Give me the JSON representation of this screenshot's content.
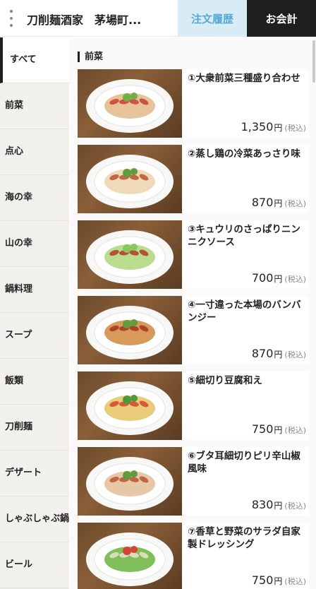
{
  "header": {
    "store_name": "刀削麺酒家　茅場町...",
    "history_label": "注文履歴",
    "checkout_label": "お会計"
  },
  "sidebar": {
    "items": [
      {
        "label": "すべて",
        "active": true
      },
      {
        "label": "前菜"
      },
      {
        "label": "点心"
      },
      {
        "label": "海の幸"
      },
      {
        "label": "山の幸"
      },
      {
        "label": "鍋料理"
      },
      {
        "label": "スープ"
      },
      {
        "label": "飯類"
      },
      {
        "label": "刀削麺"
      },
      {
        "label": "デザート"
      },
      {
        "label": "しゃぶしゃぶ鍋"
      },
      {
        "label": "ビール"
      }
    ]
  },
  "main": {
    "section_title": "前菜",
    "price_unit": "円",
    "tax_label": "(税込)",
    "items": [
      {
        "name": "①大衆前菜三種盛り合わせ",
        "price": "1,350",
        "dish": "platter"
      },
      {
        "name": "②蒸し鶏の冷菜あっさり味",
        "price": "870",
        "dish": "chicken"
      },
      {
        "name": "③キュウリのさっぱりニンニクソース",
        "price": "700",
        "dish": "cucumber"
      },
      {
        "name": "④一寸違った本場のバンバンジー",
        "price": "870",
        "dish": "bangbang"
      },
      {
        "name": "⑤細切り豆腐和え",
        "price": "750",
        "dish": "tofu"
      },
      {
        "name": "⑥ブタ耳細切りピリ辛山椒風味",
        "price": "830",
        "dish": "pigear"
      },
      {
        "name": "⑦香草と野菜のサラダ自家製ドレッシング",
        "price": "750",
        "dish": "salad"
      }
    ]
  }
}
